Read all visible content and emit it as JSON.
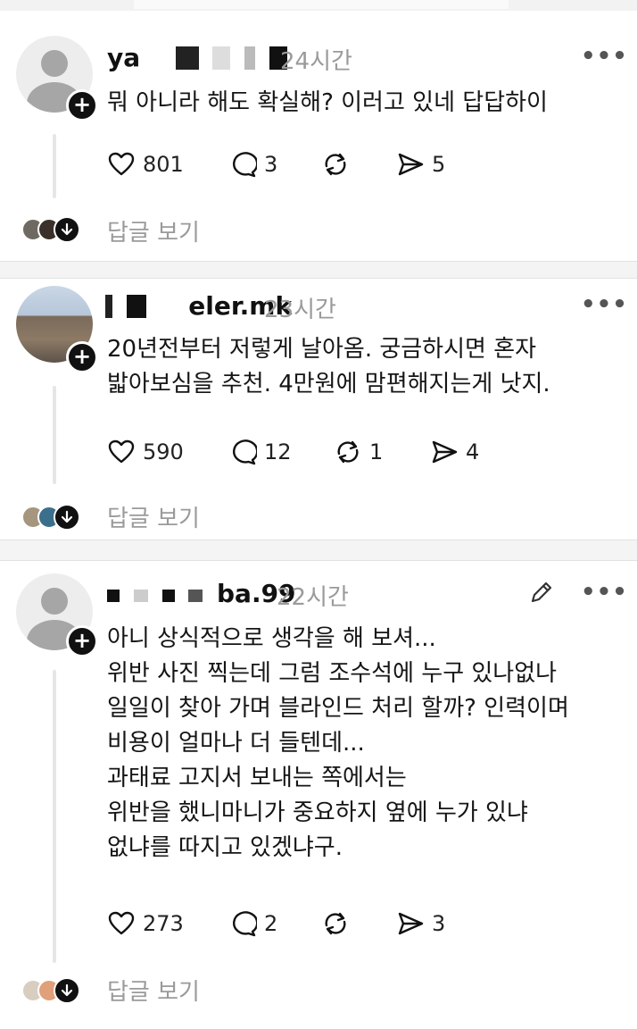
{
  "posts": [
    {
      "username_visible": "ya",
      "time": "24시간",
      "body": "뭐 아니라 해도 확실해? 이러고 있네 답답하이",
      "likes": "801",
      "comments": "3",
      "reposts": "",
      "shares": "5",
      "reply_label": "답글 보기"
    },
    {
      "username_visible": "eler.mk",
      "time": "23시간",
      "body": "20년전부터 저렇게 날아옴. 궁금하시면 혼자\n밟아보심을 추천. 4만원에 맘편해지는게 낫지.",
      "likes": "590",
      "comments": "12",
      "reposts": "1",
      "shares": "4",
      "reply_label": "답글 보기"
    },
    {
      "username_visible": "ba.99",
      "time": "22시간",
      "body": "아니 상식적으로 생각을 해 보셔...\n위반 사진 찍는데 그럼 조수석에 누구 있나없나\n일일이 찾아 가며 블라인드 처리 할까? 인력이며\n비용이 얼마나 더 들텐데...\n과태료 고지서 보내는 쪽에서는\n위반을 했니마니가 중요하지 옆에 누가 있냐\n없냐를 따지고 있겠냐구.",
      "likes": "273",
      "comments": "2",
      "reposts": "",
      "shares": "3",
      "reply_label": "답글 보기"
    }
  ],
  "icons": {
    "like": "heart-icon",
    "comment": "comment-bubble-icon",
    "repost": "repost-icon",
    "share": "send-icon",
    "more": "more-dots-icon",
    "follow": "plus-icon",
    "expand": "arrow-down-icon",
    "edit": "pencil-icon"
  },
  "ui": {
    "more_glyph": "•••",
    "follow_glyph": "+"
  }
}
